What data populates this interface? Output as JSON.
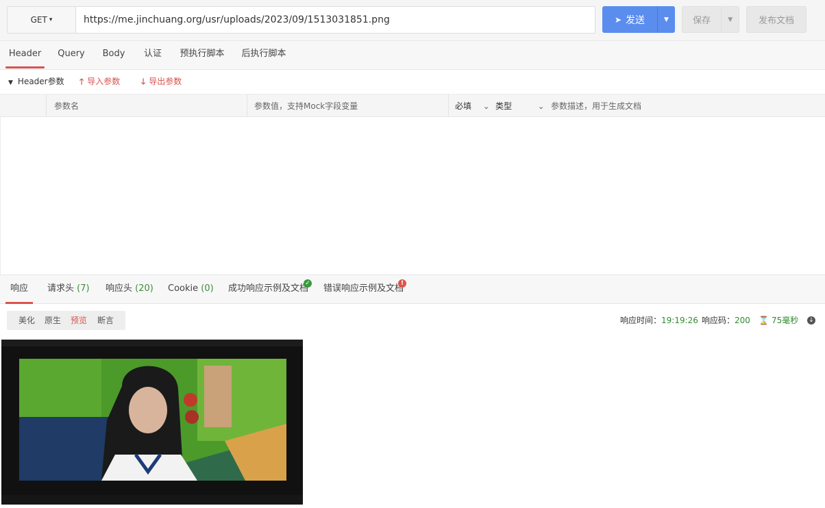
{
  "request": {
    "method": "GET",
    "url": "https://me.jinchuang.org/usr/uploads/2023/09/1513031851.png",
    "send_label": "发送",
    "save_label": "保存",
    "publish_label": "发布文档"
  },
  "request_tabs": [
    "Header",
    "Query",
    "Body",
    "认证",
    "预执行脚本",
    "后执行脚本"
  ],
  "params_section": {
    "title": "Header参数",
    "import_label": "导入参数",
    "export_label": "导出参数"
  },
  "table_header": {
    "name_placeholder": "参数名",
    "value_placeholder": "参数值，支持Mock字段变量",
    "required": "必填",
    "type": "类型",
    "desc_placeholder": "参数描述，用于生成文档"
  },
  "response_tabs": {
    "response": "响应",
    "req_headers": "请求头",
    "req_headers_count": "(7)",
    "resp_headers": "响应头",
    "resp_headers_count": "(20)",
    "cookie": "Cookie",
    "cookie_count": "(0)",
    "success_example": "成功响应示例及文档",
    "error_example": "错误响应示例及文档"
  },
  "view_modes": [
    "美化",
    "原生",
    "预览",
    "断言"
  ],
  "response_meta": {
    "time_label": "响应时间：",
    "time_value": "19:19:26",
    "code_label": "响应码：",
    "code_value": "200",
    "duration_value": "75毫秒"
  },
  "colors": {
    "accent_red": "#d9534f",
    "send_blue": "#5b8def",
    "ok_green": "#3c9a3c"
  }
}
